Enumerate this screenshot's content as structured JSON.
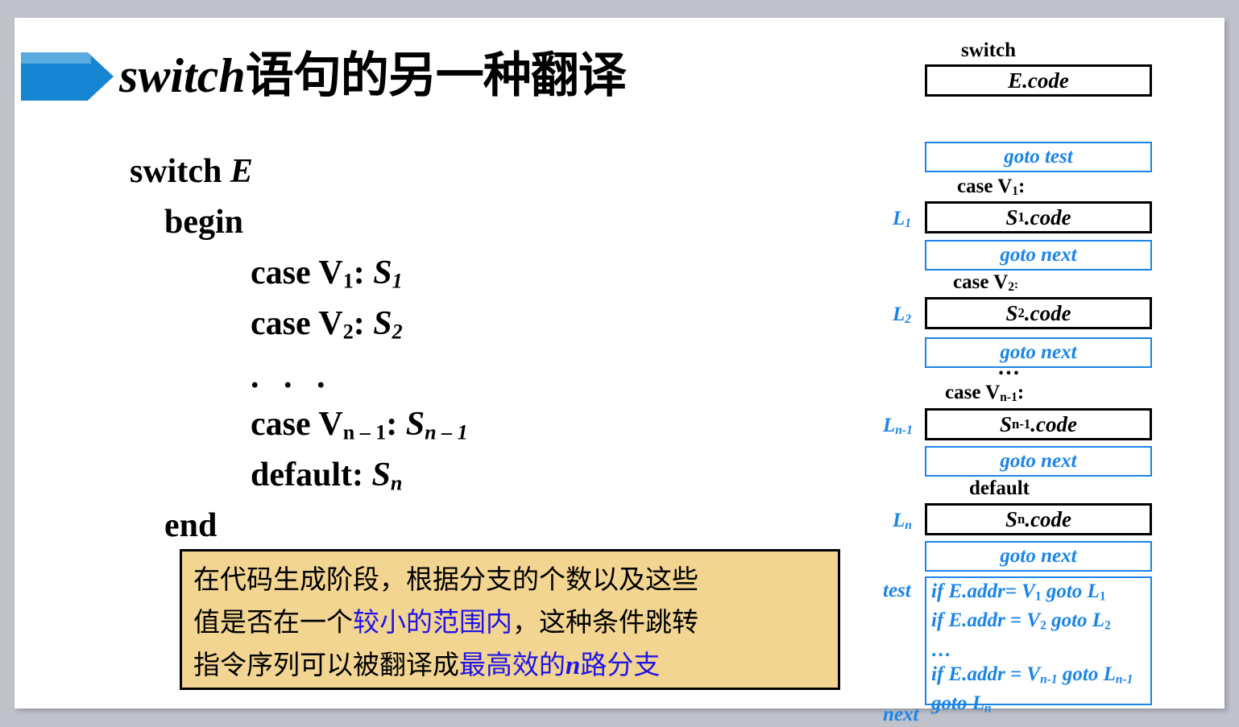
{
  "slide": {
    "title_latin": "switch",
    "title_han": "语句的另一种翻译"
  },
  "code_block": {
    "line_switch": "switch ",
    "line_switch_expr": "E",
    "line_begin": "begin",
    "case1_head": "case V",
    "case1_sub": "1",
    "case1_mid": ": ",
    "case1_stmt": "S",
    "case1_stmt_sub": "1",
    "case2_head": "case V",
    "case2_sub": "2",
    "case2_mid": ": ",
    "case2_stmt": "S",
    "case2_stmt_sub": "2",
    "ellipsis": ". . .",
    "casen_head": "case V",
    "casen_sub": "n – 1",
    "casen_mid": ": ",
    "casen_stmt": "S",
    "casen_stmt_sub": "n – 1",
    "default_head": "default: ",
    "default_stmt": "S",
    "default_stmt_sub": "n",
    "line_end": "end"
  },
  "note": {
    "l1_a": "在代码生成阶段，根据分支的个数以及这些",
    "l2_a": "值是否在一个",
    "l2_b": "较小的范围内",
    "l2_c": "，这种条件跳转",
    "l3_a": "指令序列可以被翻译成",
    "l3_b1": "最高效的",
    "l3_b2": "n",
    "l3_b3": "路分支",
    "highlight_color": "#2013e8",
    "bg_color": "#f3d592",
    "border_color": "#000000"
  },
  "diagram": {
    "black_color": "#000000",
    "blue_color": "#1a84e8",
    "caption_switch": "switch",
    "box_ecode": "E.code",
    "box_goto_test": "goto test",
    "caption_case1": "case V",
    "caption_case1_sub": "1",
    "caption_case1_colon": ":",
    "label_L1": "L",
    "label_L1_sub": "1",
    "box_s1code_s": "S",
    "box_s1code_sub": "1",
    "box_s1code_rest": ".code",
    "box_goto_next_1": "goto next",
    "caption_case2": "case V",
    "caption_case2_sub": "2",
    "caption_case2_colon": ":",
    "label_L2": "L",
    "label_L2_sub": "2",
    "box_s2code_s": "S",
    "box_s2code_sub": "2",
    "box_s2code_rest": ".code",
    "box_goto_next_2": "goto next",
    "caption_ellipsis": "…",
    "caption_casen1": "case V",
    "caption_casen1_sub": "n-1",
    "caption_casen1_colon": ":",
    "label_Ln1": "L",
    "label_Ln1_sub": "n-1",
    "box_sn1code_s": "S",
    "box_sn1code_sub": "n-1",
    "box_sn1code_rest": ".code",
    "box_goto_next_3": "goto next",
    "caption_default": "default",
    "label_Ln": "L",
    "label_Ln_sub": "n",
    "box_sncode_s": "S",
    "box_sncode_sub": "n",
    "box_sncode_rest": ".code",
    "box_goto_next_4": "goto next",
    "label_test": "test",
    "label_next": "next",
    "test_lines": {
      "t1_a": "if E.addr= V",
      "t1_sub": "1",
      "t1_b": " goto L",
      "t1_sub2": "1",
      "t2_a": "if E.addr = V",
      "t2_sub": "2",
      "t2_b": " goto L",
      "t2_sub2": "2",
      "t3": "…",
      "t4_a": "if E.addr = V",
      "t4_sub": "n-1",
      "t4_b": " goto L",
      "t4_sub2": "n-1",
      "t5_a": "goto L",
      "t5_sub": "n"
    }
  }
}
